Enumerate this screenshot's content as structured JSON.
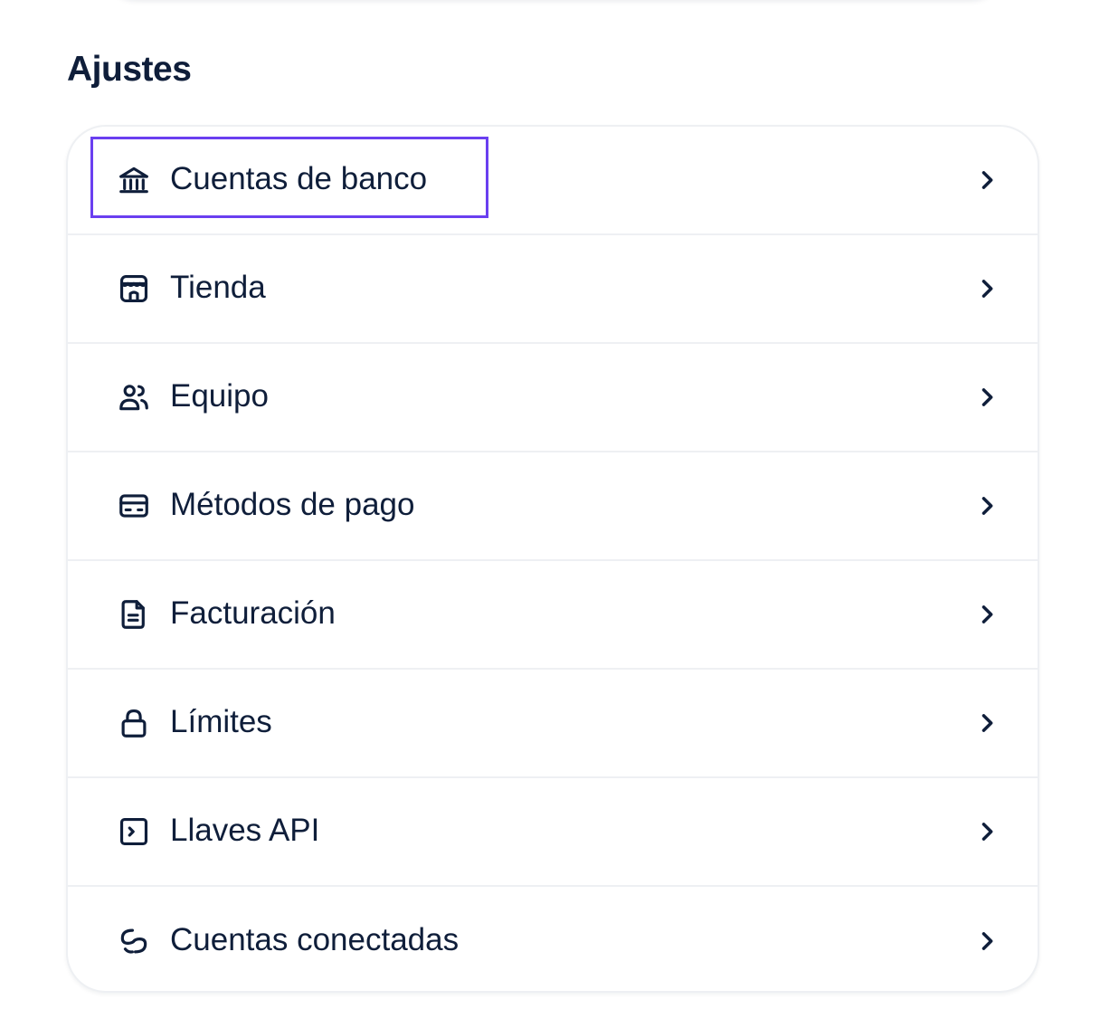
{
  "settings": {
    "title": "Ajustes",
    "items": [
      {
        "label": "Cuentas de banco",
        "icon": "bank-icon"
      },
      {
        "label": "Tienda",
        "icon": "store-icon"
      },
      {
        "label": "Equipo",
        "icon": "users-icon"
      },
      {
        "label": "Métodos de pago",
        "icon": "credit-card-icon"
      },
      {
        "label": "Facturación",
        "icon": "document-icon"
      },
      {
        "label": "Límites",
        "icon": "lock-icon"
      },
      {
        "label": "Llaves API",
        "icon": "terminal-icon"
      },
      {
        "label": "Cuentas conectadas",
        "icon": "link-icon"
      }
    ],
    "highlighted_item": "Cuentas de banco"
  },
  "colors": {
    "text": "#0f1e3a",
    "divider": "#eef0f3",
    "highlight": "#6a3ff0",
    "background": "#ffffff"
  }
}
